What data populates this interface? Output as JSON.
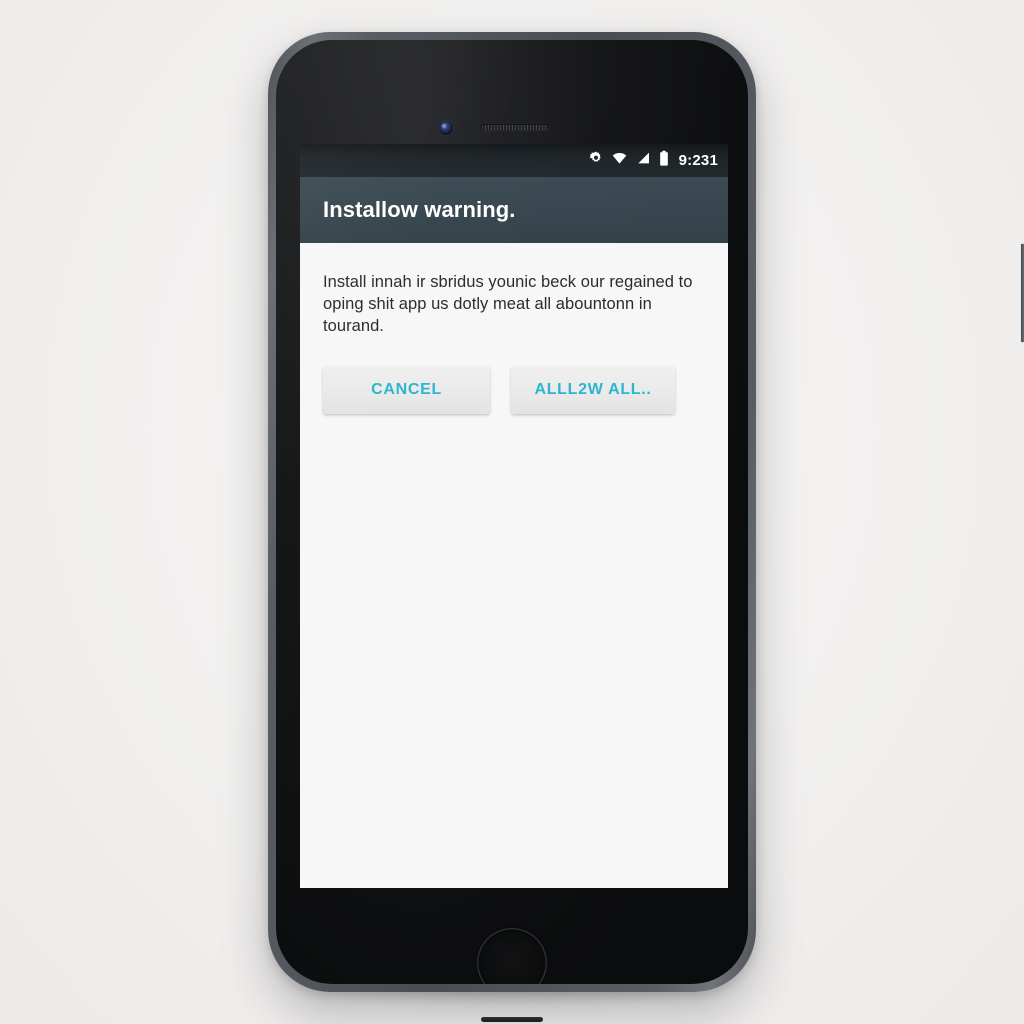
{
  "scene": {
    "background_color": "#f2f1f0",
    "device_type": "smartphone-mockup"
  },
  "device": {
    "frame_color": "#565b61",
    "bezel_color": "#0b0c0d",
    "hardware": {
      "earpiece": "earpiece-speaker",
      "front_camera": "front-camera",
      "home_button": "home-button",
      "mute_switch": "mute-switch",
      "volume_up": "volume-up-button",
      "volume_down": "volume-down-button",
      "power_button": "power-button",
      "bottom_slot": "bottom-speaker-slot"
    }
  },
  "screen": {
    "background_color": "#f7f7f7",
    "status_bar": {
      "background_color": "#1e2428",
      "time": "9:231",
      "icons": [
        {
          "name": "gear-icon",
          "label": "settings"
        },
        {
          "name": "wifi-icon",
          "label": "wifi"
        },
        {
          "name": "signal-icon",
          "label": "cellular-signal"
        },
        {
          "name": "battery-icon",
          "label": "battery"
        }
      ]
    },
    "app_bar": {
      "background_color": "#37464e",
      "title": "Installow warning.",
      "title_color": "#ffffff"
    },
    "dialog": {
      "message": "Install innah ir sbridus younic beck our regained to oping shit app us dotly meat all abountonn in tourand.",
      "message_color": "#2b2b2b",
      "buttons": [
        {
          "name": "cancel-button",
          "label": "CANCEL",
          "text_color": "#2ab6cf",
          "background_color": "#eaeaea"
        },
        {
          "name": "allow-all-button",
          "label": "ALLL2W ALL..",
          "text_color": "#2ab6cf",
          "background_color": "#eaeaea"
        }
      ]
    }
  }
}
